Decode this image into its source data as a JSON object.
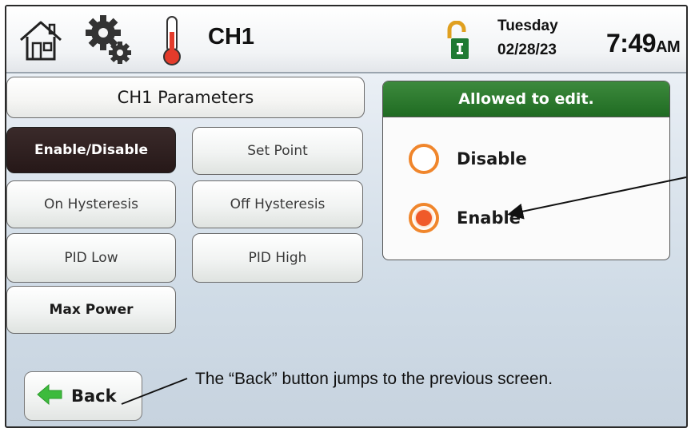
{
  "header": {
    "title": "CH1",
    "day": "Tuesday",
    "date": "02/28/23",
    "time": "7:49",
    "ampm": "AM",
    "icons": [
      "home-icon",
      "settings-gears-icon",
      "thermometer-icon",
      "unlocked-padlock-icon"
    ]
  },
  "parameters": {
    "title": "CH1 Parameters",
    "buttons": {
      "enable_disable": "Enable/Disable",
      "set_point": "Set Point",
      "on_hysteresis": "On Hysteresis",
      "off_hysteresis": "Off Hysteresis",
      "pid_low": "PID Low",
      "pid_high": "PID High",
      "max_power": "Max Power"
    },
    "selected": "Enable/Disable"
  },
  "edit_panel": {
    "status": "Allowed to edit.",
    "options": [
      {
        "label": "Disable",
        "selected": false
      },
      {
        "label": "Enable",
        "selected": true
      }
    ]
  },
  "back_button": {
    "label": "Back",
    "icon": "left-arrow-icon"
  },
  "annotation": "The “Back” button jumps to the previous screen.",
  "colors": {
    "header_green": "#1f6b22",
    "radio_orange": "#f0862c",
    "active_button": "#261818",
    "back_arrow_green": "#3dbb3d"
  }
}
